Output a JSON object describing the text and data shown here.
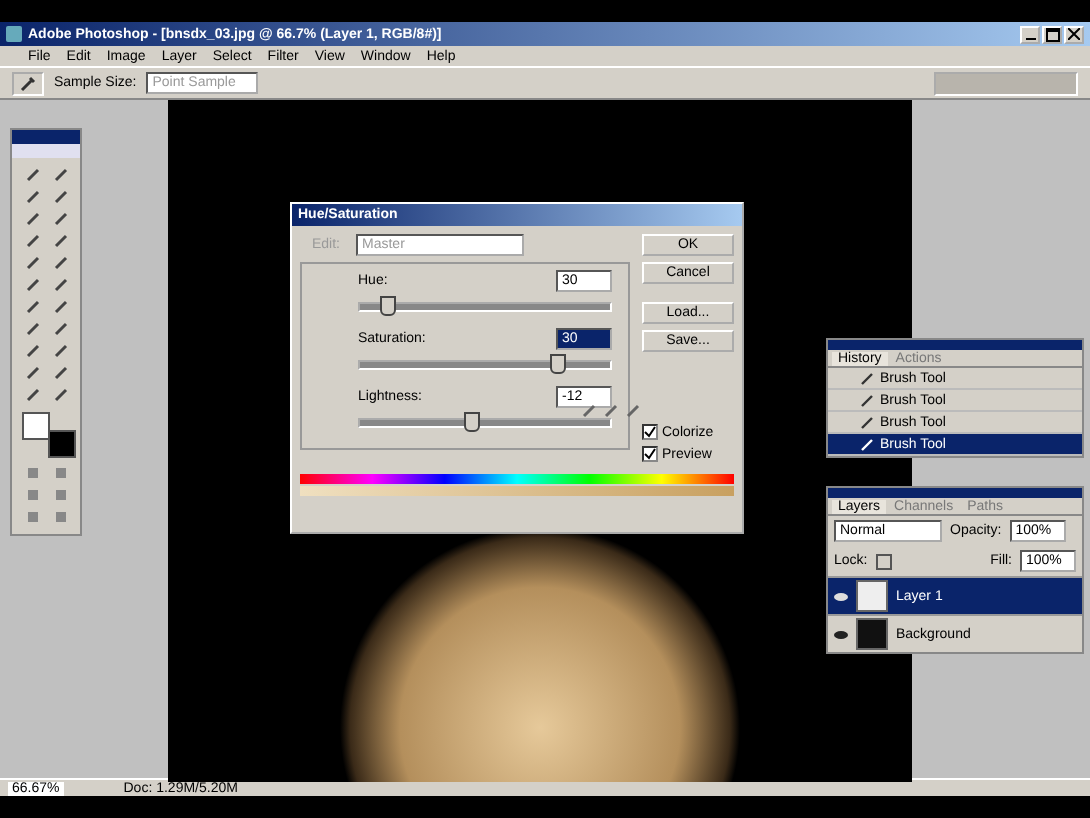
{
  "window": {
    "title": "Adobe Photoshop - [bnsdx_03.jpg @ 66.7% (Layer 1, RGB/8#)]"
  },
  "menu": [
    "File",
    "Edit",
    "Image",
    "Layer",
    "Select",
    "Filter",
    "View",
    "Window",
    "Help"
  ],
  "options_bar": {
    "label": "Sample Size:",
    "value": "Point Sample"
  },
  "hue_saturation": {
    "title": "Hue/Saturation",
    "edit_label": "Edit:",
    "edit_value": "Master",
    "sliders": [
      {
        "label": "Hue:",
        "value": "30",
        "level": 0.1,
        "selected": false
      },
      {
        "label": "Saturation:",
        "value": "30",
        "level": 0.78,
        "selected": true
      },
      {
        "label": "Lightness:",
        "value": "-12",
        "level": 0.44,
        "selected": false
      }
    ],
    "buttons": [
      "OK",
      "Cancel",
      "Load...",
      "Save..."
    ],
    "checkboxes": [
      {
        "label": "Colorize",
        "checked": true
      },
      {
        "label": "Preview",
        "checked": true
      }
    ]
  },
  "history": {
    "tabs": [
      {
        "label": "History",
        "selected": true
      },
      {
        "label": "Actions",
        "selected": false
      }
    ],
    "items": [
      {
        "label": "Brush Tool",
        "selected": false
      },
      {
        "label": "Brush Tool",
        "selected": false
      },
      {
        "label": "Brush Tool",
        "selected": false
      },
      {
        "label": "Brush Tool",
        "selected": true
      }
    ]
  },
  "layers": {
    "tabs": [
      {
        "label": "Layers",
        "selected": true
      },
      {
        "label": "Channels",
        "selected": false
      },
      {
        "label": "Paths",
        "selected": false
      }
    ],
    "blend_mode": "Normal",
    "opacity_label": "Opacity:",
    "opacity": "100%",
    "lock_label": "Lock:",
    "fill_label": "Fill:",
    "fill": "100%",
    "items": [
      {
        "name": "Layer 1",
        "selected": true,
        "kind": "light"
      },
      {
        "name": "Background",
        "selected": false,
        "kind": "dark"
      }
    ]
  },
  "status_bar": {
    "zoom": "66.67%",
    "doc": "Doc: 1.29M/5.20M"
  }
}
